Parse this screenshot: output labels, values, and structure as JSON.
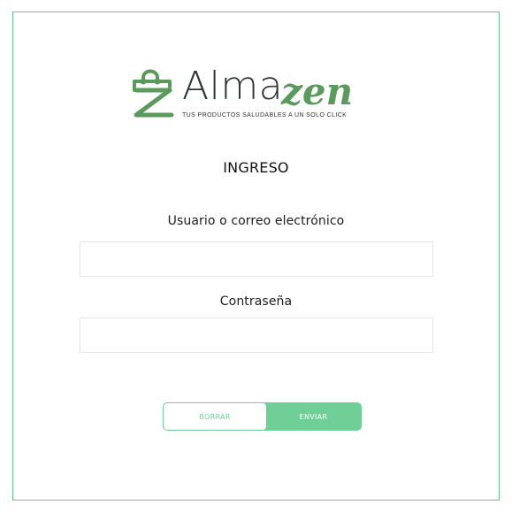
{
  "brand": {
    "name_prefix": "Alma",
    "name_suffix": "zen",
    "tagline": "TUS PRODUCTOS SALUDABLES A UN SOLO CLICK",
    "accent_color": "#5a9a5c",
    "frame_color": "#67c58f"
  },
  "form": {
    "title": "INGRESO",
    "user_label": "Usuario o correo electrónico",
    "user_value": "",
    "password_label": "Contraseña",
    "password_value": "",
    "reset_label": "BORRAR",
    "submit_label": "ENVIAR",
    "button_color": "#6fcf97"
  },
  "icons": {
    "logo_mark": "shopping-bag-icon"
  }
}
